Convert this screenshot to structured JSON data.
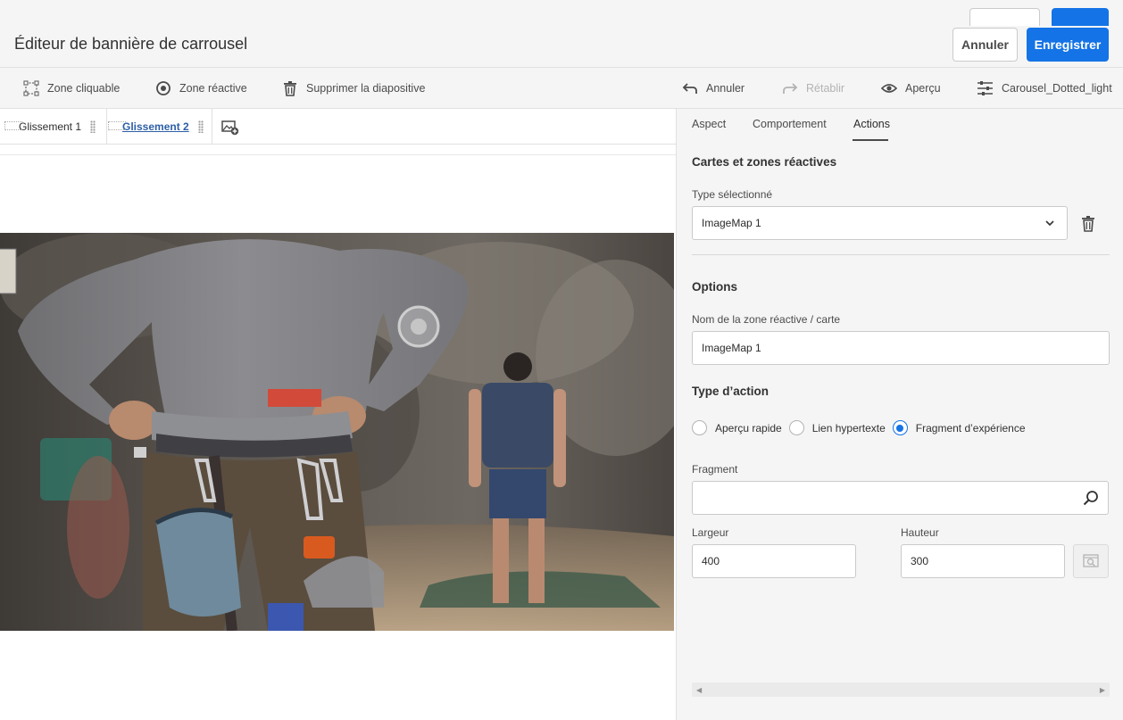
{
  "header": {
    "title": "Éditeur de bannière de carrousel",
    "cancel_label": "Annuler",
    "save_label": "Enregistrer"
  },
  "toolbar": {
    "clickable_zone": "Zone cliquable",
    "hotspot": "Zone réactive",
    "delete_slide": "Supprimer la diapositive",
    "undo": "Annuler",
    "redo": "Rétablir",
    "preview": "Aperçu",
    "preset": "Carousel_Dotted_light"
  },
  "slides": {
    "items": [
      {
        "label": "Glissement 1",
        "active": false
      },
      {
        "label": "Glissement 2",
        "active": true
      }
    ]
  },
  "panel": {
    "tabs": [
      "Aspect",
      "Comportement",
      "Actions"
    ],
    "active_tab": "Actions",
    "section_maps": "Cartes et zones réactives",
    "selected_type_label": "Type sélectionné",
    "selected_type_value": "ImageMap 1",
    "options_title": "Options",
    "name_label": "Nom de la zone réactive / carte",
    "name_value": "ImageMap 1",
    "action_type_title": "Type d’action",
    "radio_options": [
      "Aperçu rapide",
      "Lien hypertexte",
      "Fragment d’expérience"
    ],
    "radio_selected": "Fragment d’expérience",
    "fragment_label": "Fragment",
    "fragment_value": "",
    "width_label": "Largeur",
    "width_value": "400",
    "height_label": "Hauteur",
    "height_value": "300"
  },
  "colors": {
    "accent": "#1473e6",
    "active_slide": "#2d5fa5"
  }
}
